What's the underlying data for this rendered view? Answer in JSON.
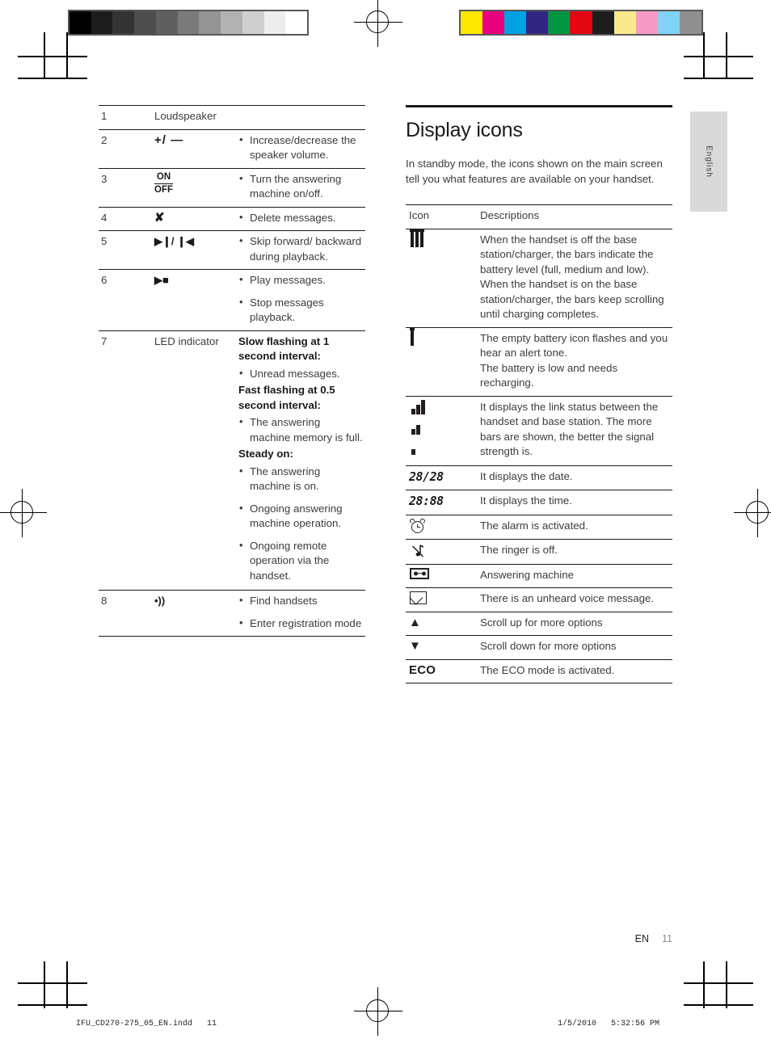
{
  "calibration": {
    "gray_swatches": [
      "#000000",
      "#1c1c1c",
      "#333333",
      "#4d4d4d",
      "#5f5f5f",
      "#7a7a7a",
      "#949494",
      "#b2b2b2",
      "#cfcfcf",
      "#ededed",
      "#ffffff"
    ],
    "color_swatches": [
      "#ffe800",
      "#e6007e",
      "#00a0e3",
      "#312783",
      "#009640",
      "#e30613",
      "#1d1d1b",
      "#fbea8c",
      "#f59bc6",
      "#7fd4f5",
      "#8f8f8f"
    ]
  },
  "lang_tab": {
    "label": "English"
  },
  "parts_table": {
    "rows": [
      {
        "num": "1",
        "symbol_kind": "text",
        "symbol_text": "Loudspeaker",
        "items": []
      },
      {
        "num": "2",
        "symbol_kind": "plus-minus",
        "symbol_text": "+/ —",
        "items": [
          "Increase/decrease the speaker volume."
        ]
      },
      {
        "num": "3",
        "symbol_kind": "on-off",
        "symbol_on": "ON",
        "symbol_off": "OFF",
        "items": [
          "Turn the answering machine on/off."
        ]
      },
      {
        "num": "4",
        "symbol_kind": "x",
        "symbol_text": "✘",
        "items": [
          "Delete messages."
        ]
      },
      {
        "num": "5",
        "symbol_kind": "transport",
        "symbol_text": "▶❙/ ❙◀",
        "items": [
          "Skip forward/ backward during playback."
        ]
      },
      {
        "num": "6",
        "symbol_kind": "transport",
        "symbol_text": "▶■",
        "items": [
          "Play messages.",
          "Stop messages playback."
        ]
      },
      {
        "num": "7",
        "symbol_kind": "text",
        "symbol_text": "LED indicator",
        "blocks": [
          {
            "heading": "Slow flashing at 1 second interval:",
            "items": [
              "Unread messages."
            ]
          },
          {
            "heading": "Fast flashing at 0.5 second interval:",
            "items": [
              "The answering machine memory is full."
            ]
          },
          {
            "heading": "Steady on:",
            "items": [
              "The answering machine is on.",
              "Ongoing answering machine operation.",
              "Ongoing remote operation via the handset."
            ]
          }
        ]
      },
      {
        "num": "8",
        "symbol_kind": "paging",
        "symbol_text": "•))",
        "items": [
          "Find handsets",
          "Enter registration mode"
        ]
      }
    ]
  },
  "display_icons": {
    "title": "Display icons",
    "intro": "In standby mode, the icons shown on the main screen tell you what features are available on your handset.",
    "header": {
      "icon": "Icon",
      "descriptions": "Descriptions"
    },
    "rows": [
      {
        "icon_kind": "battery-levels",
        "description": "When the handset is off the base station/charger, the bars indicate the battery level (full, medium and low).\nWhen the handset is on the base station/charger, the bars keep scrolling until charging completes."
      },
      {
        "icon_kind": "battery-empty",
        "description": "The empty battery icon flashes and you hear an alert tone.\nThe battery is low and needs recharging."
      },
      {
        "icon_kind": "signal-bars",
        "description": "It displays the link status between the handset and base station. The more bars are shown, the better the signal strength is."
      },
      {
        "icon_kind": "lcd-date",
        "icon_text": "28/28",
        "description": "It displays the date."
      },
      {
        "icon_kind": "lcd-time",
        "icon_text": "28:88",
        "description": "It displays the time."
      },
      {
        "icon_kind": "alarm",
        "description": "The alarm is activated."
      },
      {
        "icon_kind": "ringer-off",
        "description": "The ringer is off."
      },
      {
        "icon_kind": "answering-machine",
        "description": "Answering machine"
      },
      {
        "icon_kind": "voice-message",
        "description": "There is an unheard voice message."
      },
      {
        "icon_kind": "scroll-up",
        "icon_text": "▲",
        "description": "Scroll up for more options"
      },
      {
        "icon_kind": "scroll-down",
        "icon_text": "▼",
        "description": "Scroll down for more options"
      },
      {
        "icon_kind": "eco",
        "icon_text": "ECO",
        "description": "The ECO mode is activated."
      }
    ]
  },
  "page_footer": {
    "locale": "EN",
    "page_number": "11"
  },
  "print_footer": {
    "file": "IFU_CD270-275_05_EN.indd   11",
    "timestamp": "1/5/2010   5:32:56 PM"
  }
}
